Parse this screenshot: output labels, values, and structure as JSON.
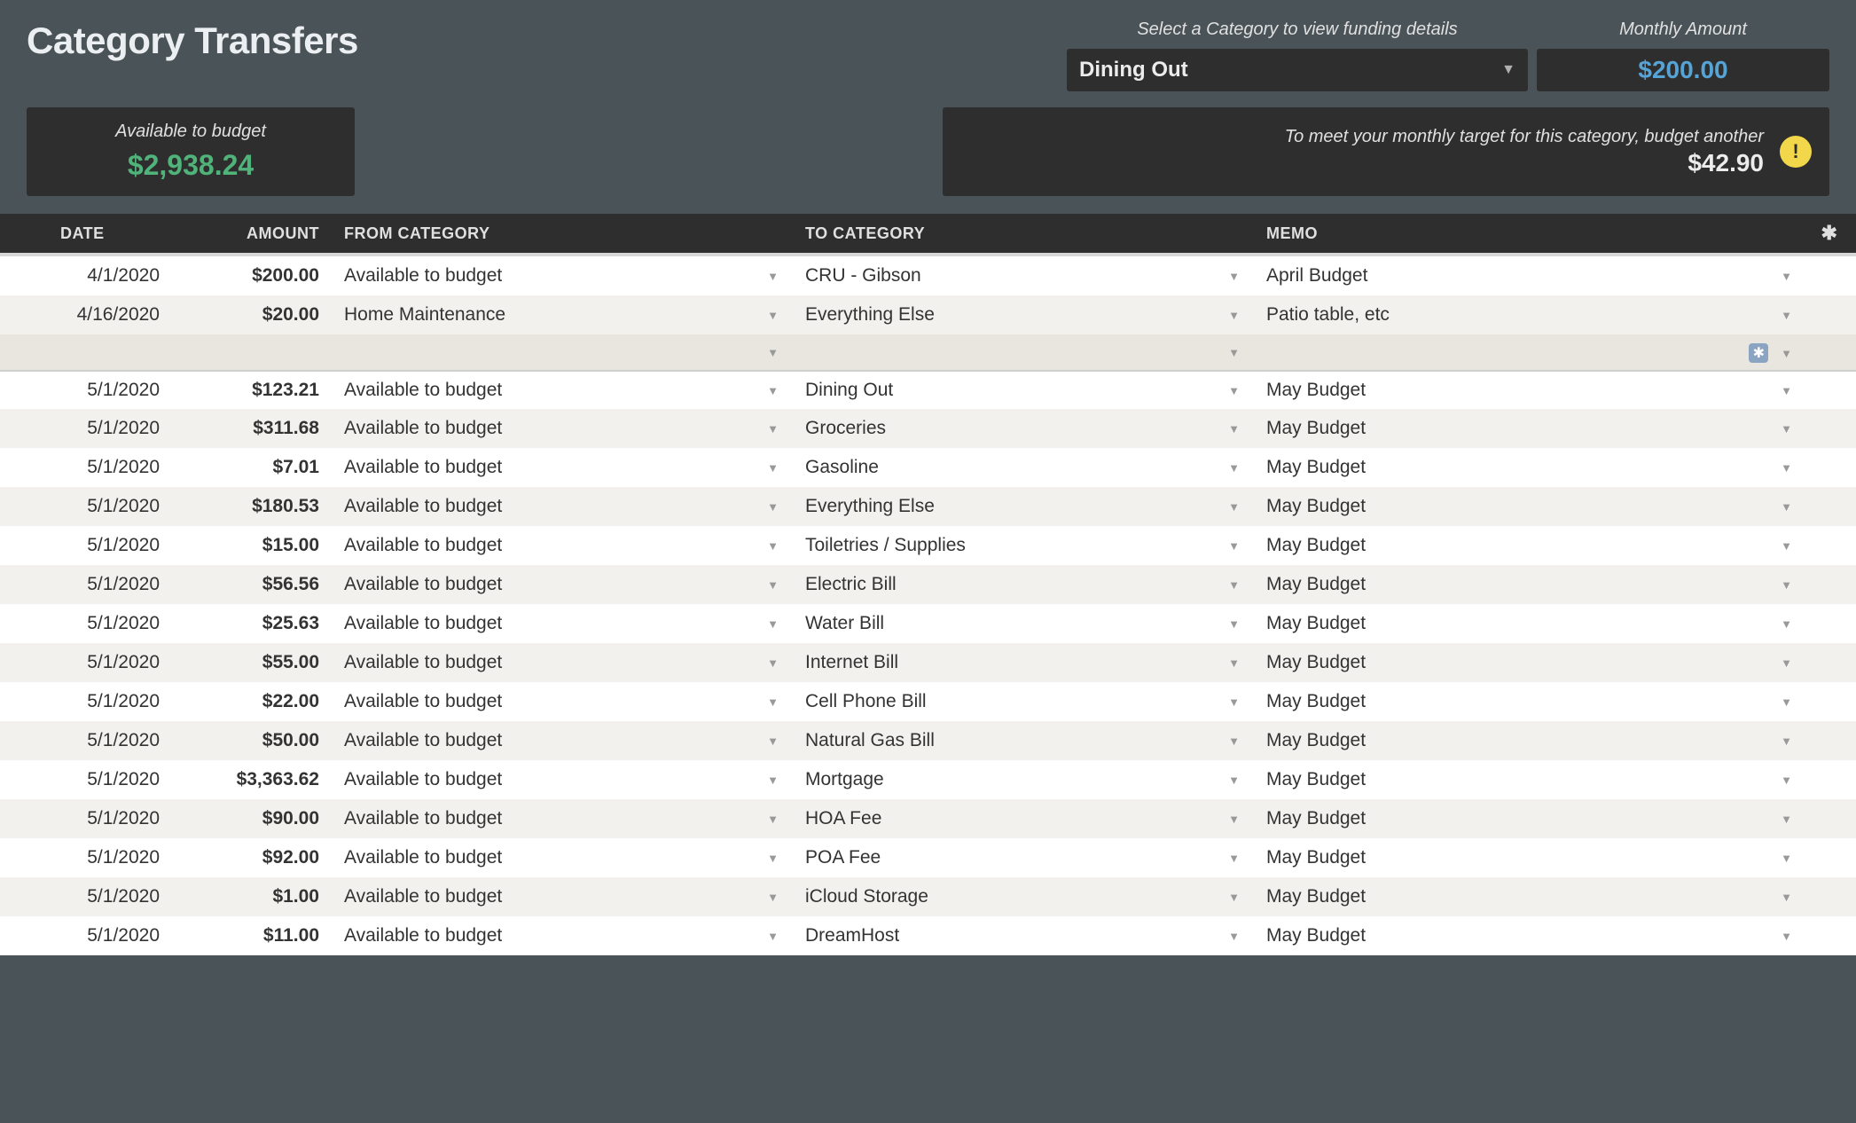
{
  "title": "Category Transfers",
  "category_prompt": "Select a Category to view funding details",
  "selected_category": "Dining Out",
  "monthly_label": "Monthly Amount",
  "monthly_amount": "$200.00",
  "available_label": "Available to budget",
  "available_value": "$2,938.24",
  "target_text": "To meet your monthly target for this category, budget another",
  "target_amount": "$42.90",
  "columns": {
    "date": "DATE",
    "amount": "AMOUNT",
    "from": "FROM CATEGORY",
    "to": "TO CATEGORY",
    "memo": "MEMO"
  },
  "rows": [
    {
      "date": "4/1/2020",
      "amount": "$200.00",
      "from": "Available to budget",
      "to": "CRU - Gibson",
      "memo": "April Budget",
      "alt": false
    },
    {
      "date": "4/16/2020",
      "amount": "$20.00",
      "from": "Home Maintenance",
      "to": "Everything Else",
      "memo": "Patio table, etc",
      "alt": true
    },
    {
      "blank": true
    },
    {
      "date": "5/1/2020",
      "amount": "$123.21",
      "from": "Available to budget",
      "to": "Dining Out",
      "memo": "May Budget",
      "alt": false,
      "thin": true
    },
    {
      "date": "5/1/2020",
      "amount": "$311.68",
      "from": "Available to budget",
      "to": "Groceries",
      "memo": "May Budget",
      "alt": true
    },
    {
      "date": "5/1/2020",
      "amount": "$7.01",
      "from": "Available to budget",
      "to": "Gasoline",
      "memo": "May Budget",
      "alt": false
    },
    {
      "date": "5/1/2020",
      "amount": "$180.53",
      "from": "Available to budget",
      "to": "Everything Else",
      "memo": "May Budget",
      "alt": true
    },
    {
      "date": "5/1/2020",
      "amount": "$15.00",
      "from": "Available to budget",
      "to": "Toiletries / Supplies",
      "memo": "May Budget",
      "alt": false
    },
    {
      "date": "5/1/2020",
      "amount": "$56.56",
      "from": "Available to budget",
      "to": "Electric Bill",
      "memo": "May Budget",
      "alt": true
    },
    {
      "date": "5/1/2020",
      "amount": "$25.63",
      "from": "Available to budget",
      "to": "Water Bill",
      "memo": "May Budget",
      "alt": false
    },
    {
      "date": "5/1/2020",
      "amount": "$55.00",
      "from": "Available to budget",
      "to": "Internet Bill",
      "memo": "May Budget",
      "alt": true
    },
    {
      "date": "5/1/2020",
      "amount": "$22.00",
      "from": "Available to budget",
      "to": "Cell Phone Bill",
      "memo": "May Budget",
      "alt": false
    },
    {
      "date": "5/1/2020",
      "amount": "$50.00",
      "from": "Available to budget",
      "to": "Natural Gas Bill",
      "memo": "May Budget",
      "alt": true
    },
    {
      "date": "5/1/2020",
      "amount": "$3,363.62",
      "from": "Available to budget",
      "to": "Mortgage",
      "memo": "May Budget",
      "alt": false
    },
    {
      "date": "5/1/2020",
      "amount": "$90.00",
      "from": "Available to budget",
      "to": "HOA Fee",
      "memo": "May Budget",
      "alt": true
    },
    {
      "date": "5/1/2020",
      "amount": "$92.00",
      "from": "Available to budget",
      "to": "POA Fee",
      "memo": "May Budget",
      "alt": false
    },
    {
      "date": "5/1/2020",
      "amount": "$1.00",
      "from": "Available to budget",
      "to": "iCloud Storage",
      "memo": "May Budget",
      "alt": true
    },
    {
      "date": "5/1/2020",
      "amount": "$11.00",
      "from": "Available to budget",
      "to": "DreamHost",
      "memo": "May Budget",
      "alt": false
    }
  ]
}
